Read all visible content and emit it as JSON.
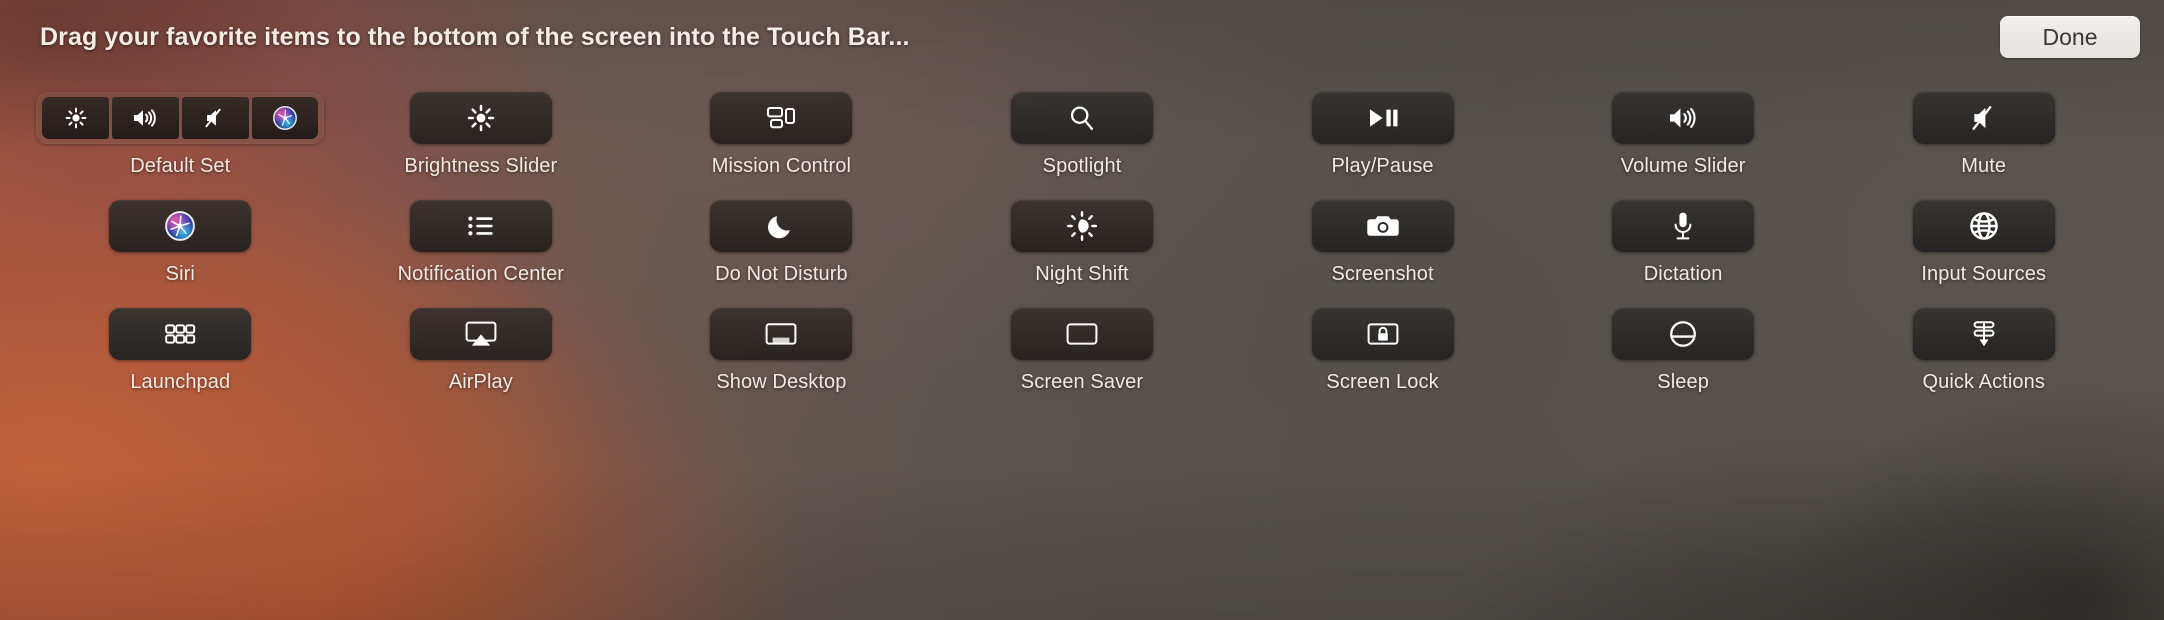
{
  "header": {
    "title": "Drag your favorite items to the bottom of the screen into the Touch Bar...",
    "done_label": "Done"
  },
  "theme": {
    "tile_color": "#2a2320",
    "tile_color_neutral": "#262422",
    "label_color": "#f3e8e2",
    "done_button_bg": "#eae6e2",
    "done_button_text": "#3b3733",
    "background_warm": "#a9573a",
    "background_cool": "#56504b"
  },
  "default_set": {
    "label": "Default Set",
    "segments": [
      {
        "name": "brightness",
        "icon": "brightness-icon"
      },
      {
        "name": "volume",
        "icon": "volume-icon"
      },
      {
        "name": "mute",
        "icon": "mute-icon"
      },
      {
        "name": "siri",
        "icon": "siri-icon"
      }
    ]
  },
  "rows": [
    [
      {
        "label": "Default Set",
        "icon": "default-set-strip",
        "type": "strip"
      },
      {
        "label": "Brightness Slider",
        "icon": "brightness-icon",
        "type": "warm"
      },
      {
        "label": "Mission Control",
        "icon": "mission-control-icon",
        "type": "warm"
      },
      {
        "label": "Spotlight",
        "icon": "search-icon",
        "type": "neutral"
      },
      {
        "label": "Play/Pause",
        "icon": "play-pause-icon",
        "type": "neutral"
      },
      {
        "label": "Volume Slider",
        "icon": "volume-icon",
        "type": "neutral"
      },
      {
        "label": "Mute",
        "icon": "mute-icon",
        "type": "neutral"
      }
    ],
    [
      {
        "label": "Siri",
        "icon": "siri-icon",
        "type": "warm"
      },
      {
        "label": "Notification Center",
        "icon": "list-icon",
        "type": "warm"
      },
      {
        "label": "Do Not Disturb",
        "icon": "moon-icon",
        "type": "warm"
      },
      {
        "label": "Night Shift",
        "icon": "night-shift-icon",
        "type": "warm"
      },
      {
        "label": "Screenshot",
        "icon": "camera-icon",
        "type": "neutral"
      },
      {
        "label": "Dictation",
        "icon": "microphone-icon",
        "type": "neutral"
      },
      {
        "label": "Input Sources",
        "icon": "globe-icon",
        "type": "neutral"
      }
    ],
    [
      {
        "label": "Launchpad",
        "icon": "grid-icon",
        "type": "neutral"
      },
      {
        "label": "AirPlay",
        "icon": "airplay-icon",
        "type": "warm"
      },
      {
        "label": "Show Desktop",
        "icon": "show-desktop-icon",
        "type": "warm"
      },
      {
        "label": "Screen Saver",
        "icon": "screen-saver-icon",
        "type": "warm"
      },
      {
        "label": "Screen Lock",
        "icon": "screen-lock-icon",
        "type": "neutral"
      },
      {
        "label": "Sleep",
        "icon": "sleep-icon",
        "type": "neutral"
      },
      {
        "label": "Quick Actions",
        "icon": "quick-actions-icon",
        "type": "neutral"
      }
    ]
  ]
}
